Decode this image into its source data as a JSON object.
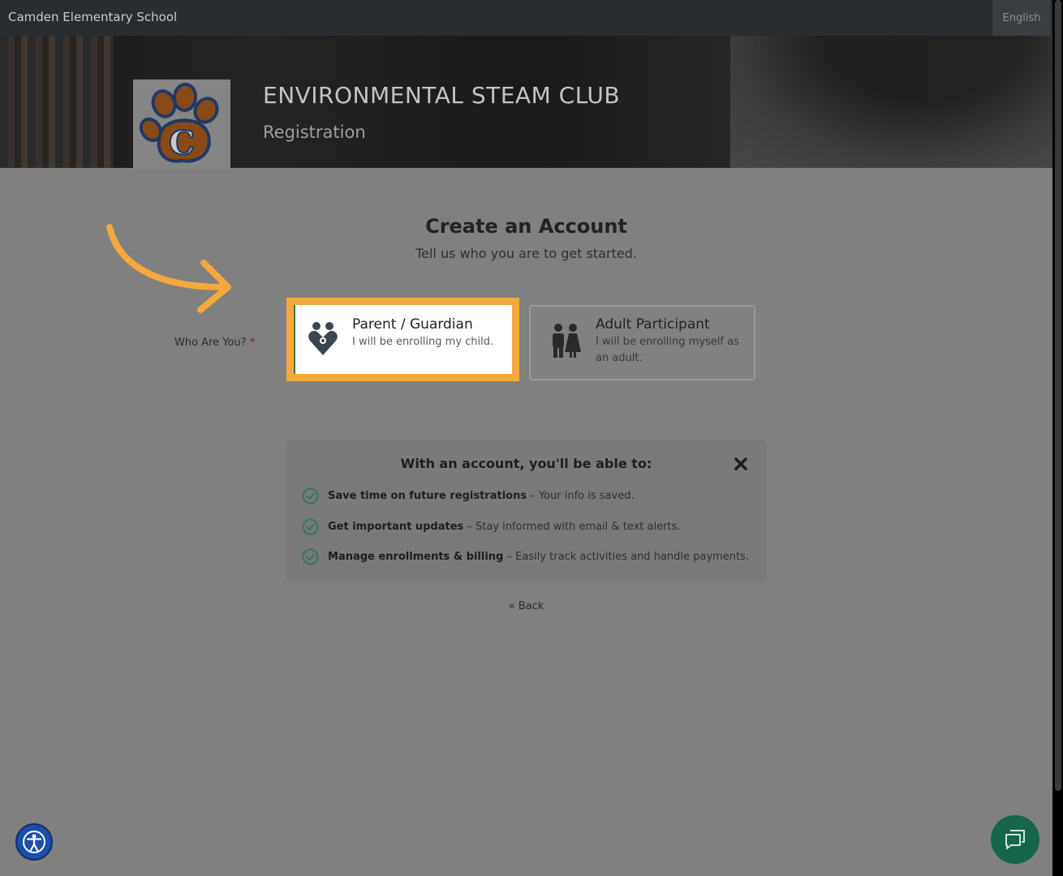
{
  "topbar": {
    "school_name": "Camden Elementary School",
    "language_button": "English"
  },
  "hero": {
    "title": "ENVIRONMENTAL STEAM CLUB",
    "subtitle": "Registration",
    "logo_icon": "paw-logo-icon"
  },
  "page": {
    "heading": "Create an Account",
    "subheading": "Tell us who you are to get started."
  },
  "who_field": {
    "label": "Who Are You?",
    "required_mark": "*"
  },
  "options": [
    {
      "title": "Parent / Guardian",
      "description": "I will be enrolling my child.",
      "icon": "family-heart-icon",
      "selected": true
    },
    {
      "title": "Adult Participant",
      "description": "I will be enrolling myself as an adult.",
      "icon": "adults-icon",
      "selected": false
    }
  ],
  "info_box": {
    "title": "With an account, you'll be able to:",
    "benefits": [
      {
        "strong": "Save time on future registrations",
        "text": " – Your info is saved."
      },
      {
        "strong": "Get important updates",
        "text": " – Stay informed with email & text alerts."
      },
      {
        "strong": "Manage enrollments & billing",
        "text": " – Easily track activities and handle payments."
      }
    ]
  },
  "back_link": "« Back",
  "colors": {
    "highlight": "#f4a93b",
    "check": "#2e7a5a",
    "chat": "#15664a",
    "accessibility": "#1a4faa"
  }
}
